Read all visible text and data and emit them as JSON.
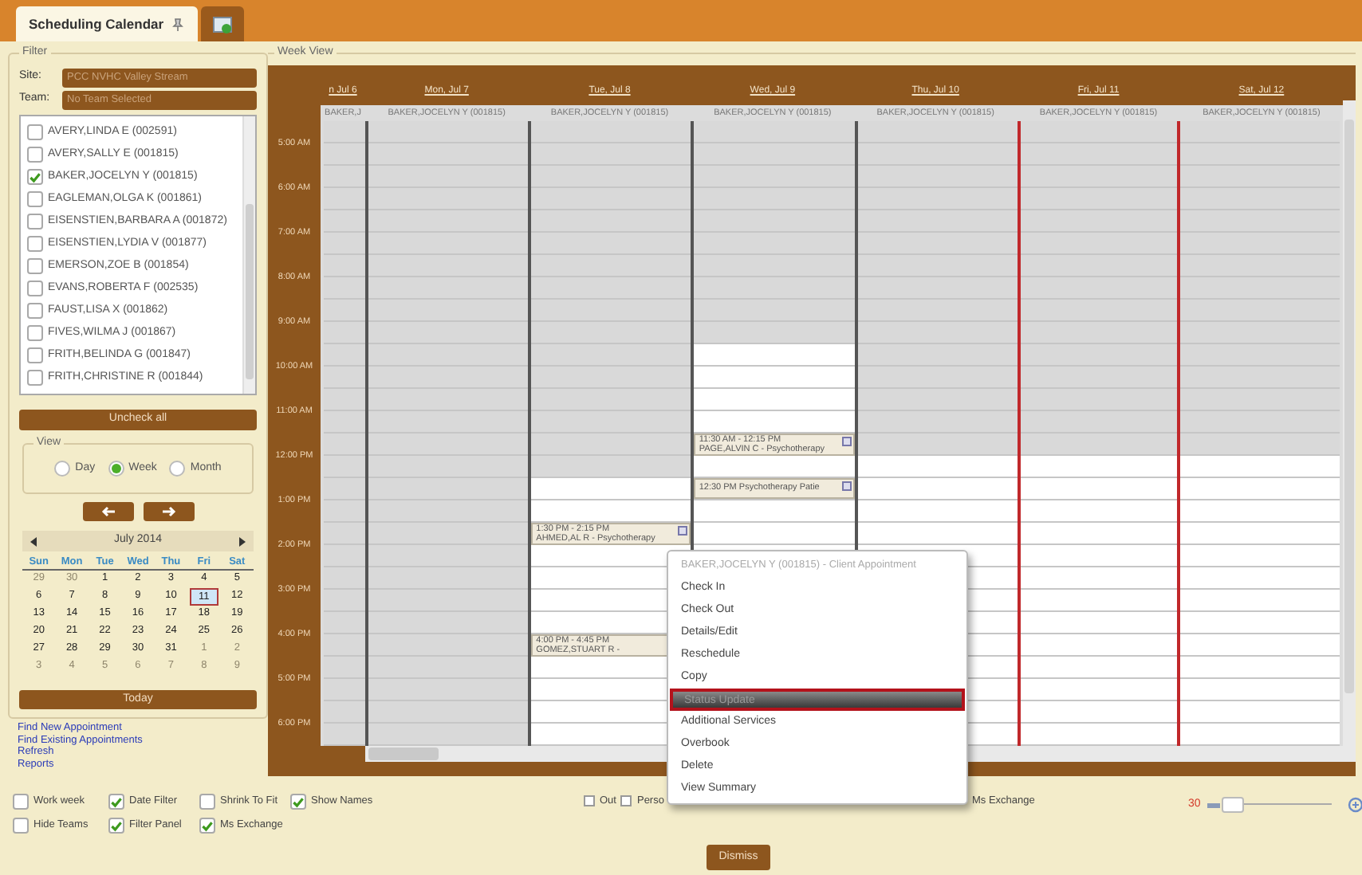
{
  "tabs": [
    {
      "kind": "text",
      "label": "Scheduling Calendar",
      "selected": true
    },
    {
      "kind": "icon",
      "selected": false
    }
  ],
  "filter": {
    "title": "Filter",
    "site_label": "Site:",
    "site_value": "PCC NVHC Valley Stream",
    "team_label": "Team:",
    "team_value": "No Team Selected",
    "staff": [
      {
        "name": "AVERY,LINDA E (002591)",
        "checked": false
      },
      {
        "name": "AVERY,SALLY E (001815)",
        "checked": false
      },
      {
        "name": "BAKER,JOCELYN Y (001815)",
        "checked": true
      },
      {
        "name": "EAGLEMAN,OLGA K (001861)",
        "checked": false
      },
      {
        "name": "EISENSTIEN,BARBARA A (001872)",
        "checked": false
      },
      {
        "name": "EISENSTIEN,LYDIA V (001877)",
        "checked": false
      },
      {
        "name": "EMERSON,ZOE B (001854)",
        "checked": false
      },
      {
        "name": "EVANS,ROBERTA F (002535)",
        "checked": false
      },
      {
        "name": "FAUST,LISA X (001862)",
        "checked": false
      },
      {
        "name": "FIVES,WILMA J (001867)",
        "checked": false
      },
      {
        "name": "FRITH,BELINDA G (001847)",
        "checked": false
      },
      {
        "name": "FRITH,CHRISTINE R (001844)",
        "checked": false
      }
    ],
    "uncheck_all": "Uncheck all",
    "view": {
      "title": "View",
      "options": [
        {
          "label": "Day",
          "selected": false
        },
        {
          "label": "Week",
          "selected": true
        },
        {
          "label": "Month",
          "selected": false
        }
      ]
    },
    "mini_calendar": {
      "month": "July 2014",
      "weekdays": [
        "Sun",
        "Mon",
        "Tue",
        "Wed",
        "Thu",
        "Fri",
        "Sat"
      ],
      "weeks": [
        [
          {
            "day": "29",
            "other_month": true,
            "selected": false
          },
          {
            "day": "30",
            "other_month": true,
            "selected": false
          },
          {
            "day": "1",
            "other_month": false,
            "selected": false
          },
          {
            "day": "2",
            "other_month": false,
            "selected": false
          },
          {
            "day": "3",
            "other_month": false,
            "selected": false
          },
          {
            "day": "4",
            "other_month": false,
            "selected": false
          },
          {
            "day": "5",
            "other_month": false,
            "selected": false
          }
        ],
        [
          {
            "day": "6",
            "other_month": false,
            "selected": false
          },
          {
            "day": "7",
            "other_month": false,
            "selected": false
          },
          {
            "day": "8",
            "other_month": false,
            "selected": false
          },
          {
            "day": "9",
            "other_month": false,
            "selected": false
          },
          {
            "day": "10",
            "other_month": false,
            "selected": false
          },
          {
            "day": "11",
            "other_month": false,
            "selected": true
          },
          {
            "day": "12",
            "other_month": false,
            "selected": false
          }
        ],
        [
          {
            "day": "13",
            "other_month": false,
            "selected": false
          },
          {
            "day": "14",
            "other_month": false,
            "selected": false
          },
          {
            "day": "15",
            "other_month": false,
            "selected": false
          },
          {
            "day": "16",
            "other_month": false,
            "selected": false
          },
          {
            "day": "17",
            "other_month": false,
            "selected": false
          },
          {
            "day": "18",
            "other_month": false,
            "selected": false
          },
          {
            "day": "19",
            "other_month": false,
            "selected": false
          }
        ],
        [
          {
            "day": "20",
            "other_month": false,
            "selected": false
          },
          {
            "day": "21",
            "other_month": false,
            "selected": false
          },
          {
            "day": "22",
            "other_month": false,
            "selected": false
          },
          {
            "day": "23",
            "other_month": false,
            "selected": false
          },
          {
            "day": "24",
            "other_month": false,
            "selected": false
          },
          {
            "day": "25",
            "other_month": false,
            "selected": false
          },
          {
            "day": "26",
            "other_month": false,
            "selected": false
          }
        ],
        [
          {
            "day": "27",
            "other_month": false,
            "selected": false
          },
          {
            "day": "28",
            "other_month": false,
            "selected": false
          },
          {
            "day": "29",
            "other_month": false,
            "selected": false
          },
          {
            "day": "30",
            "other_month": false,
            "selected": false
          },
          {
            "day": "31",
            "other_month": false,
            "selected": false
          },
          {
            "day": "1",
            "other_month": true,
            "selected": false
          },
          {
            "day": "2",
            "other_month": true,
            "selected": false
          }
        ],
        [
          {
            "day": "3",
            "other_month": true,
            "selected": false
          },
          {
            "day": "4",
            "other_month": true,
            "selected": false
          },
          {
            "day": "5",
            "other_month": true,
            "selected": false
          },
          {
            "day": "6",
            "other_month": true,
            "selected": false
          },
          {
            "day": "7",
            "other_month": true,
            "selected": false
          },
          {
            "day": "8",
            "other_month": true,
            "selected": false
          },
          {
            "day": "9",
            "other_month": true,
            "selected": false
          }
        ]
      ],
      "today_button": "Today"
    }
  },
  "links": [
    "Find New Appointment",
    "Find Existing Appointments",
    "Refresh",
    "Reports"
  ],
  "week_view": {
    "title": "Week View",
    "times": [
      "5:00 AM",
      "6:00 AM",
      "7:00 AM",
      "8:00 AM",
      "9:00 AM",
      "10:00 AM",
      "11:00 AM",
      "12:00 PM",
      "1:00 PM",
      "2:00 PM",
      "3:00 PM",
      "4:00 PM",
      "5:00 PM",
      "6:00 PM"
    ],
    "days": [
      {
        "label": "n Jul 6",
        "staff": "BAKER,J",
        "selected": false,
        "slots": [
          {
            "open": false
          },
          {
            "open": false
          },
          {
            "open": false
          },
          {
            "open": false
          },
          {
            "open": false
          },
          {
            "open": false
          },
          {
            "open": false
          },
          {
            "open": false
          },
          {
            "open": false
          },
          {
            "open": false
          },
          {
            "open": false
          },
          {
            "open": false
          },
          {
            "open": false
          },
          {
            "open": false
          },
          {
            "open": false
          },
          {
            "open": false
          },
          {
            "open": false
          },
          {
            "open": false
          },
          {
            "open": false
          },
          {
            "open": false
          },
          {
            "open": false
          },
          {
            "open": false
          },
          {
            "open": false
          },
          {
            "open": false
          },
          {
            "open": false
          },
          {
            "open": false
          },
          {
            "open": false
          },
          {
            "open": false
          }
        ]
      },
      {
        "label": "Mon, Jul 7",
        "staff": "BAKER,JOCELYN Y (001815)",
        "selected": false,
        "slots": [
          {
            "open": false
          },
          {
            "open": false
          },
          {
            "open": false
          },
          {
            "open": false
          },
          {
            "open": false
          },
          {
            "open": false
          },
          {
            "open": false
          },
          {
            "open": false
          },
          {
            "open": false
          },
          {
            "open": false
          },
          {
            "open": false
          },
          {
            "open": false
          },
          {
            "open": false
          },
          {
            "open": false
          },
          {
            "open": false
          },
          {
            "open": false
          },
          {
            "open": false
          },
          {
            "open": false
          },
          {
            "open": false
          },
          {
            "open": false
          },
          {
            "open": false
          },
          {
            "open": false
          },
          {
            "open": false
          },
          {
            "open": false
          },
          {
            "open": false
          },
          {
            "open": false
          },
          {
            "open": false
          },
          {
            "open": false
          }
        ]
      },
      {
        "label": "Tue, Jul 8",
        "staff": "BAKER,JOCELYN Y (001815)",
        "selected": false,
        "slots": [
          {
            "open": false
          },
          {
            "open": false
          },
          {
            "open": false
          },
          {
            "open": false
          },
          {
            "open": false
          },
          {
            "open": false
          },
          {
            "open": false
          },
          {
            "open": false
          },
          {
            "open": false
          },
          {
            "open": false
          },
          {
            "open": false
          },
          {
            "open": false
          },
          {
            "open": false
          },
          {
            "open": false
          },
          {
            "open": false
          },
          {
            "open": false
          },
          {
            "open": true
          },
          {
            "open": true
          },
          {
            "appointment": {
              "lines": [
                "1:30 PM - 2:15 PM",
                "AHMED,AL R - Psychotherapy"
              ],
              "icon": true
            }
          },
          {
            "open": true
          },
          {
            "open": true
          },
          {
            "open": true
          },
          {
            "open": true
          },
          {
            "appointment": {
              "lines": [
                "4:00 PM - 4:45 PM",
                "GOMEZ,STUART R -"
              ]
            }
          },
          {
            "open": true
          },
          {
            "open": true
          },
          {
            "open": true
          },
          {
            "open": true
          }
        ]
      },
      {
        "label": "Wed, Jul 9",
        "staff": "BAKER,JOCELYN Y (001815)",
        "selected": false,
        "slots": [
          {
            "open": false
          },
          {
            "open": false
          },
          {
            "open": false
          },
          {
            "open": false
          },
          {
            "open": false
          },
          {
            "open": false
          },
          {
            "open": false
          },
          {
            "open": false
          },
          {
            "open": false
          },
          {
            "open": false
          },
          {
            "open": true
          },
          {
            "open": true
          },
          {
            "open": true
          },
          {
            "open": true
          },
          {
            "appointment": {
              "lines": [
                "11:30 AM - 12:15 PM",
                "PAGE,ALVIN C - Psychotherapy"
              ],
              "icon": true
            }
          },
          {
            "open": true
          },
          {
            "appointment": {
              "lines": [
                "12:30 PM Psychotherapy Patie"
              ],
              "icon": true
            }
          },
          {
            "open": true
          },
          {
            "open": true
          }
        ]
      },
      {
        "label": "Thu, Jul 10",
        "staff": "BAKER,JOCELYN Y (001815)",
        "selected": false,
        "slots": [
          {
            "open": false
          },
          {
            "open": false
          },
          {
            "open": false
          },
          {
            "open": false
          },
          {
            "open": false
          },
          {
            "open": false
          },
          {
            "open": false
          },
          {
            "open": false
          },
          {
            "open": false
          },
          {
            "open": false
          },
          {
            "open": false
          },
          {
            "open": false
          },
          {
            "open": false
          },
          {
            "open": false
          },
          {
            "open": false
          },
          {
            "open": true
          },
          {
            "open": true
          },
          {
            "open": true
          },
          {
            "open": true
          },
          {
            "open": true
          },
          {
            "open": true
          },
          {
            "open": true
          },
          {
            "open": true
          },
          {
            "open": true
          },
          {
            "open": true
          },
          {
            "open": true
          },
          {
            "open": true
          },
          {
            "open": true
          }
        ]
      },
      {
        "label": "Fri, Jul 11",
        "staff": "BAKER,JOCELYN Y (001815)",
        "selected": true,
        "slots": [
          {
            "open": false
          },
          {
            "open": false
          },
          {
            "open": false
          },
          {
            "open": false
          },
          {
            "open": false
          },
          {
            "open": false
          },
          {
            "open": false
          },
          {
            "open": false
          },
          {
            "open": false
          },
          {
            "open": false
          },
          {
            "open": false
          },
          {
            "open": false
          },
          {
            "open": false
          },
          {
            "open": false
          },
          {
            "open": false
          },
          {
            "open": true
          },
          {
            "open": true
          },
          {
            "open": true
          },
          {
            "open": true
          },
          {
            "open": true
          },
          {
            "open": true
          },
          {
            "open": true
          },
          {
            "open": true
          },
          {
            "open": true
          },
          {
            "open": true
          },
          {
            "open": true
          },
          {
            "open": true
          },
          {
            "open": true
          }
        ]
      },
      {
        "label": "Sat, Jul 12",
        "staff": "BAKER,JOCELYN Y (001815)",
        "selected": false,
        "slots": [
          {
            "open": false
          },
          {
            "open": false
          },
          {
            "open": false
          },
          {
            "open": false
          },
          {
            "open": false
          },
          {
            "open": false
          },
          {
            "open": false
          },
          {
            "open": false
          },
          {
            "open": false
          },
          {
            "open": false
          },
          {
            "open": false
          },
          {
            "open": false
          },
          {
            "open": false
          },
          {
            "open": false
          },
          {
            "open": false
          },
          {
            "open": true
          },
          {
            "open": true
          },
          {
            "open": true
          },
          {
            "open": true
          },
          {
            "open": true
          },
          {
            "open": true
          },
          {
            "open": true
          },
          {
            "open": true
          },
          {
            "open": true
          },
          {
            "open": true
          },
          {
            "open": true
          },
          {
            "open": true
          },
          {
            "open": true
          }
        ]
      }
    ]
  },
  "context_menu": {
    "header": "BAKER,JOCELYN Y (001815) - Client Appointment",
    "items": [
      {
        "label": "Check In",
        "selected": false
      },
      {
        "label": "Check Out",
        "selected": false
      },
      {
        "label": "Details/Edit",
        "selected": false
      },
      {
        "label": "Reschedule",
        "selected": false
      },
      {
        "label": "Copy",
        "selected": false
      },
      {
        "label": "Status Update",
        "selected": true
      },
      {
        "label": "Additional Services",
        "selected": false
      },
      {
        "label": "Overbook",
        "selected": false
      },
      {
        "label": "Delete",
        "selected": false
      },
      {
        "label": "View Summary",
        "selected": false
      }
    ]
  },
  "options": [
    {
      "label": "Work week",
      "checked": false
    },
    {
      "label": "Date Filter",
      "checked": true
    },
    {
      "label": "Shrink To Fit",
      "checked": false
    },
    {
      "label": "Show Names",
      "checked": true
    },
    {
      "label": "Hide Teams",
      "checked": false
    },
    {
      "label": "Filter Panel",
      "checked": true
    },
    {
      "label": "Ms Exchange",
      "checked": true
    }
  ],
  "legend": [
    {
      "kind": "check",
      "label": "Out",
      "checked": false
    },
    {
      "kind": "check",
      "label": "Perso",
      "checked": false
    },
    {
      "kind": "text",
      "label": "Ms Exchange"
    }
  ],
  "zoom": {
    "value": "30",
    "level": 0.06
  },
  "dismiss": "Dismiss"
}
